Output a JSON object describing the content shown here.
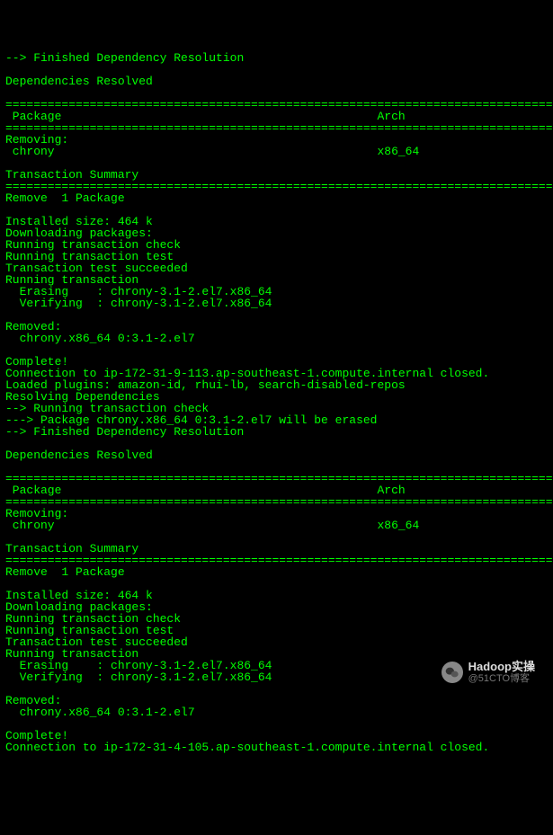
{
  "terminal": {
    "lines": [
      "--> Finished Dependency Resolution",
      "",
      "Dependencies Resolved",
      "",
      "================================================================================================",
      " Package                                             Arch",
      "================================================================================================",
      "Removing:",
      " chrony                                              x86_64",
      "",
      "Transaction Summary",
      "================================================================================================",
      "Remove  1 Package",
      "",
      "Installed size: 464 k",
      "Downloading packages:",
      "Running transaction check",
      "Running transaction test",
      "Transaction test succeeded",
      "Running transaction",
      "  Erasing    : chrony-3.1-2.el7.x86_64",
      "  Verifying  : chrony-3.1-2.el7.x86_64",
      "",
      "Removed:",
      "  chrony.x86_64 0:3.1-2.el7",
      "",
      "Complete!",
      "Connection to ip-172-31-9-113.ap-southeast-1.compute.internal closed.",
      "Loaded plugins: amazon-id, rhui-lb, search-disabled-repos",
      "Resolving Dependencies",
      "--> Running transaction check",
      "---> Package chrony.x86_64 0:3.1-2.el7 will be erased",
      "--> Finished Dependency Resolution",
      "",
      "Dependencies Resolved",
      "",
      "================================================================================================",
      " Package                                             Arch",
      "================================================================================================",
      "Removing:",
      " chrony                                              x86_64",
      "",
      "Transaction Summary",
      "================================================================================================",
      "Remove  1 Package",
      "",
      "Installed size: 464 k",
      "Downloading packages:",
      "Running transaction check",
      "Running transaction test",
      "Transaction test succeeded",
      "Running transaction",
      "  Erasing    : chrony-3.1-2.el7.x86_64",
      "  Verifying  : chrony-3.1-2.el7.x86_64",
      "",
      "Removed:",
      "  chrony.x86_64 0:3.1-2.el7",
      "",
      "Complete!",
      "Connection to ip-172-31-4-105.ap-southeast-1.compute.internal closed."
    ]
  },
  "watermark": {
    "title": "Hadoop实操",
    "subtitle": "@51CTO博客"
  }
}
